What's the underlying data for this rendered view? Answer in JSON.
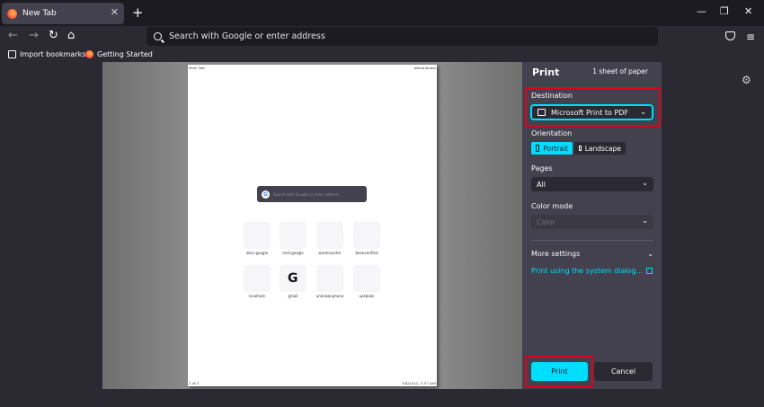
{
  "tab": {
    "title": "New Tab",
    "close": "✕"
  },
  "window_controls": {
    "new_tab": "+",
    "minimize": "—",
    "restore": "❐",
    "close": "✕"
  },
  "nav": {
    "back": "←",
    "forward": "→",
    "reload": "↻",
    "home": "⌂",
    "menu": "≡"
  },
  "urlbar": {
    "placeholder": "Search with Google or enter address"
  },
  "bookmarks": [
    {
      "label": "Import bookmarks...",
      "icon": "import-icon"
    },
    {
      "label": "Getting Started",
      "icon": "firefox-icon"
    }
  ],
  "preview_page": {
    "header_left": "New Tab",
    "header_right": "about:home",
    "search_text": "Search with Google or enter address",
    "tiles": [
      {
        "label": "docs.google"
      },
      {
        "label": "mail.google"
      },
      {
        "label": "wordcounter"
      },
      {
        "label": "beenverified"
      },
      {
        "label": "localhost"
      },
      {
        "label": "gmail",
        "glyph": "G"
      },
      {
        "label": "unknownphone"
      },
      {
        "label": "upsbook"
      }
    ],
    "footer_left": "1 of 1",
    "footer_right": "5/4/2022, 1:57 AM"
  },
  "print_panel": {
    "title": "Print",
    "sheets": "1 sheet of paper",
    "destination_label": "Destination",
    "destination_value": "Microsoft Print to PDF",
    "orientation_label": "Orientation",
    "portrait_label": "Portrait",
    "landscape_label": "Landscape",
    "pages_label": "Pages",
    "pages_value": "All",
    "color_mode_label": "Color mode",
    "color_mode_value": "Color",
    "more_settings_label": "More settings",
    "system_dialog_label": "Print using the system dialog...",
    "print_button": "Print",
    "cancel_button": "Cancel",
    "chevron": "⌄"
  },
  "colors": {
    "accent": "#00ddff",
    "highlight": "#e0001b",
    "panel": "#42414d",
    "background": "#2b2a33"
  }
}
